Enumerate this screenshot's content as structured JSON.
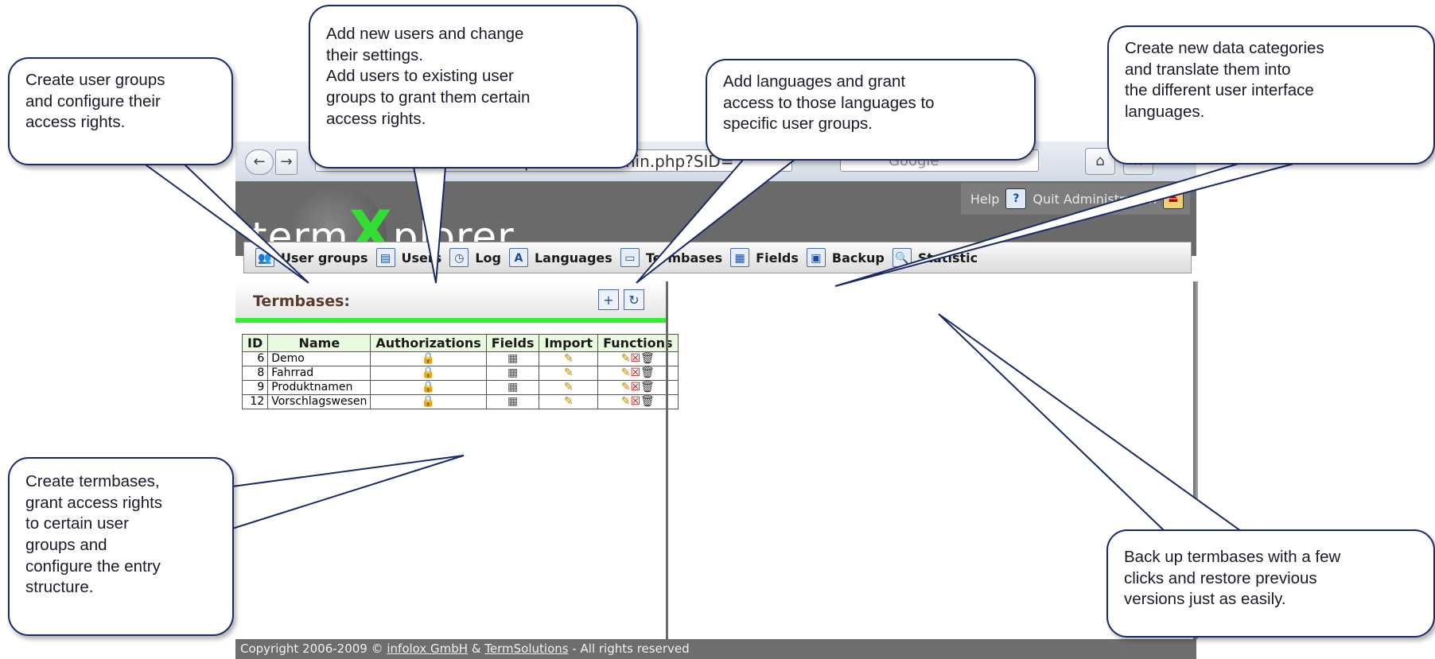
{
  "browser": {
    "url": "demo.termxplorer.de/admin.php?SID=",
    "search_placeholder": "Google",
    "back_glyph": "←",
    "forward_glyph": "→",
    "home_glyph": "⌂",
    "bookmark_glyph": "★"
  },
  "app": {
    "logo_prefix": "term",
    "logo_x": "X",
    "logo_suffix": "plorer",
    "help_label": "Help",
    "quit_label": "Quit Administration"
  },
  "menu": [
    {
      "label": "User groups",
      "icon": "user-groups-icon"
    },
    {
      "label": "Users",
      "icon": "users-icon"
    },
    {
      "label": "Log",
      "icon": "log-icon"
    },
    {
      "label": "Languages",
      "icon": "languages-icon"
    },
    {
      "label": "Termbases",
      "icon": "termbases-icon"
    },
    {
      "label": "Fields",
      "icon": "fields-icon"
    },
    {
      "label": "Backup",
      "icon": "backup-icon"
    },
    {
      "label": "Statistic",
      "icon": "statistic-icon"
    }
  ],
  "termbases": {
    "title": "Termbases:",
    "columns": [
      "ID",
      "Name",
      "Authorizations",
      "Fields",
      "Import",
      "Functions"
    ],
    "rows": [
      {
        "id": "6",
        "name": "Demo"
      },
      {
        "id": "8",
        "name": "Fahrrad"
      },
      {
        "id": "9",
        "name": "Produktnamen"
      },
      {
        "id": "12",
        "name": "Vorschlagswesen"
      }
    ]
  },
  "footer": {
    "prefix": "Copyright 2006-2009 © ",
    "link1": "infolox GmbH",
    "amp": " & ",
    "link2": "TermSolutions",
    "suffix": " - All rights reserved"
  },
  "callouts": {
    "user_groups": [
      "Create user groups",
      "and configure their",
      "access rights."
    ],
    "users": [
      "Add new users and change",
      "their settings.",
      "Add users to existing user",
      "groups to grant them certain",
      "access rights."
    ],
    "languages": [
      "Add languages and grant",
      "access to those languages to",
      "specific user groups."
    ],
    "fields": [
      "Create new data categories",
      "and translate them into",
      "the different user interface",
      "languages."
    ],
    "termbases": [
      "Create termbases,",
      "grant access rights",
      "to certain user",
      "groups and",
      "configure the entry",
      "structure."
    ],
    "backup": [
      "Back up termbases with a few",
      "clicks and restore previous",
      "versions just as easily."
    ]
  },
  "colors": {
    "callout_border": "#1a2a66",
    "accent_green": "#33ee33",
    "header_gray": "#6a6a6a"
  }
}
